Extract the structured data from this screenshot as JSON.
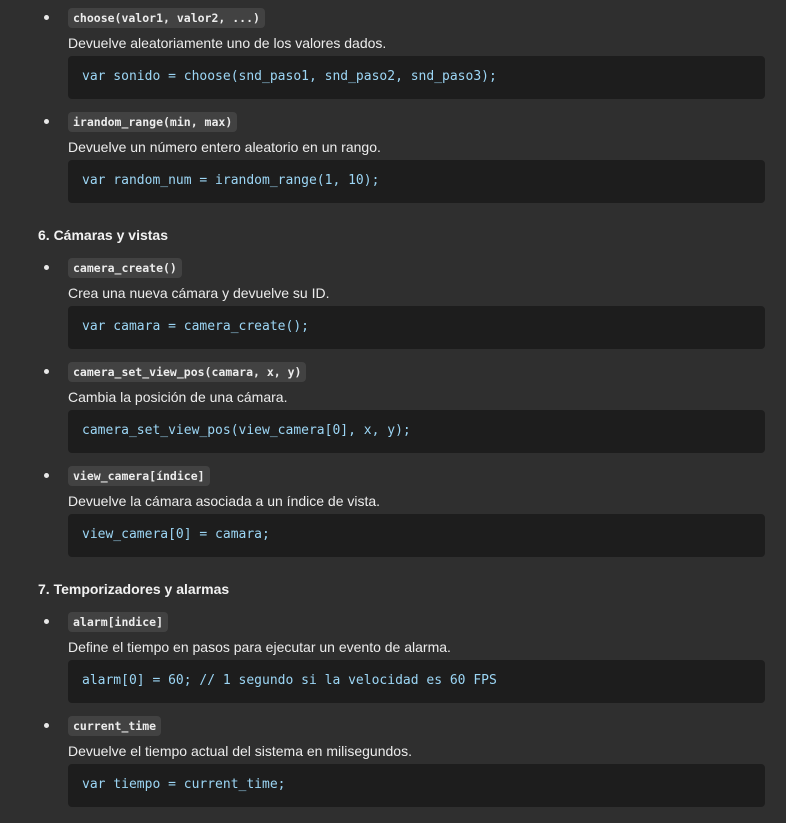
{
  "items_top": [
    {
      "signature": "choose(valor1, valor2, ...)",
      "description": "Devuelve aleatoriamente uno de los valores dados.",
      "code": "var sonido = choose(snd_paso1, snd_paso2, snd_paso3);"
    },
    {
      "signature": "irandom_range(min, max)",
      "description": "Devuelve un número entero aleatorio en un rango.",
      "code": "var random_num = irandom_range(1, 10);"
    }
  ],
  "section6": {
    "heading": "6. Cámaras y vistas",
    "items": [
      {
        "signature": "camera_create()",
        "description": "Crea una nueva cámara y devuelve su ID.",
        "code": "var camara = camera_create();"
      },
      {
        "signature": "camera_set_view_pos(camara, x, y)",
        "description": "Cambia la posición de una cámara.",
        "code": "camera_set_view_pos(view_camera[0], x, y);"
      },
      {
        "signature": "view_camera[índice]",
        "description": "Devuelve la cámara asociada a un índice de vista.",
        "code": "view_camera[0] = camara;"
      }
    ]
  },
  "section7": {
    "heading": "7. Temporizadores y alarmas",
    "items": [
      {
        "signature": "alarm[indice]",
        "description": "Define el tiempo en pasos para ejecutar un evento de alarma.",
        "code": "alarm[0] = 60; // 1 segundo si la velocidad es 60 FPS"
      },
      {
        "signature": "current_time",
        "description": "Devuelve el tiempo actual del sistema en milisegundos.",
        "code": "var tiempo = current_time;"
      }
    ]
  }
}
